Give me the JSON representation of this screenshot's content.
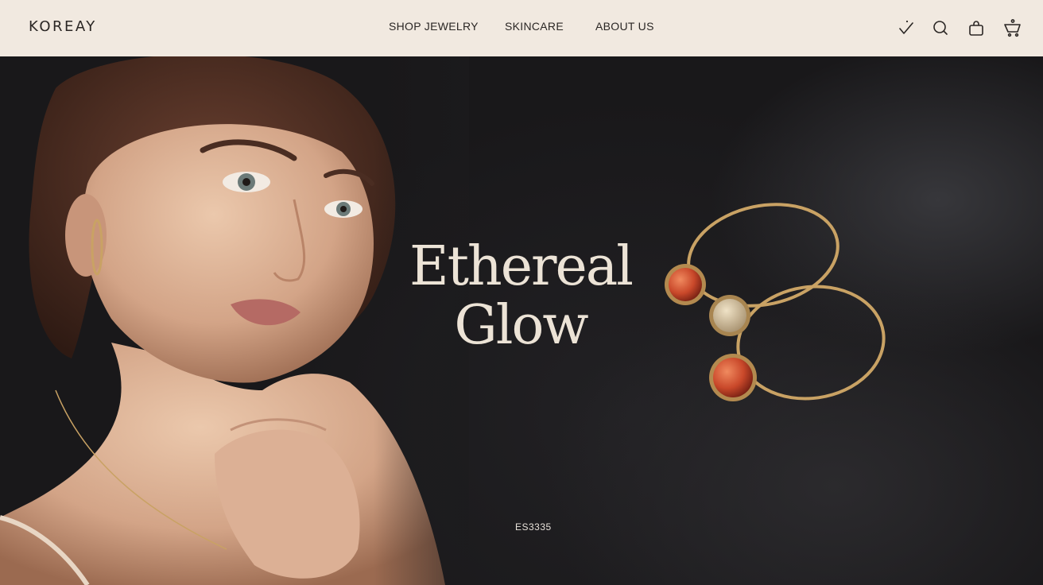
{
  "header": {
    "logo": "KOREAY",
    "nav": [
      {
        "label": "SHOP JEWELRY"
      },
      {
        "label": "SKINCARE"
      },
      {
        "label": "ABOUT US"
      }
    ],
    "icons": [
      "wishlist-icon",
      "search-icon",
      "bag-icon",
      "cart-icon"
    ]
  },
  "hero": {
    "headline_line1": "Ethereal",
    "headline_line2": "Glow",
    "code": "ES3335"
  },
  "colors": {
    "header_bg": "#f1e9e0",
    "hero_bg": "#1c1b1d",
    "headline": "#ece3d6",
    "gold": "#c9a264",
    "stone": "#c94a2a"
  }
}
